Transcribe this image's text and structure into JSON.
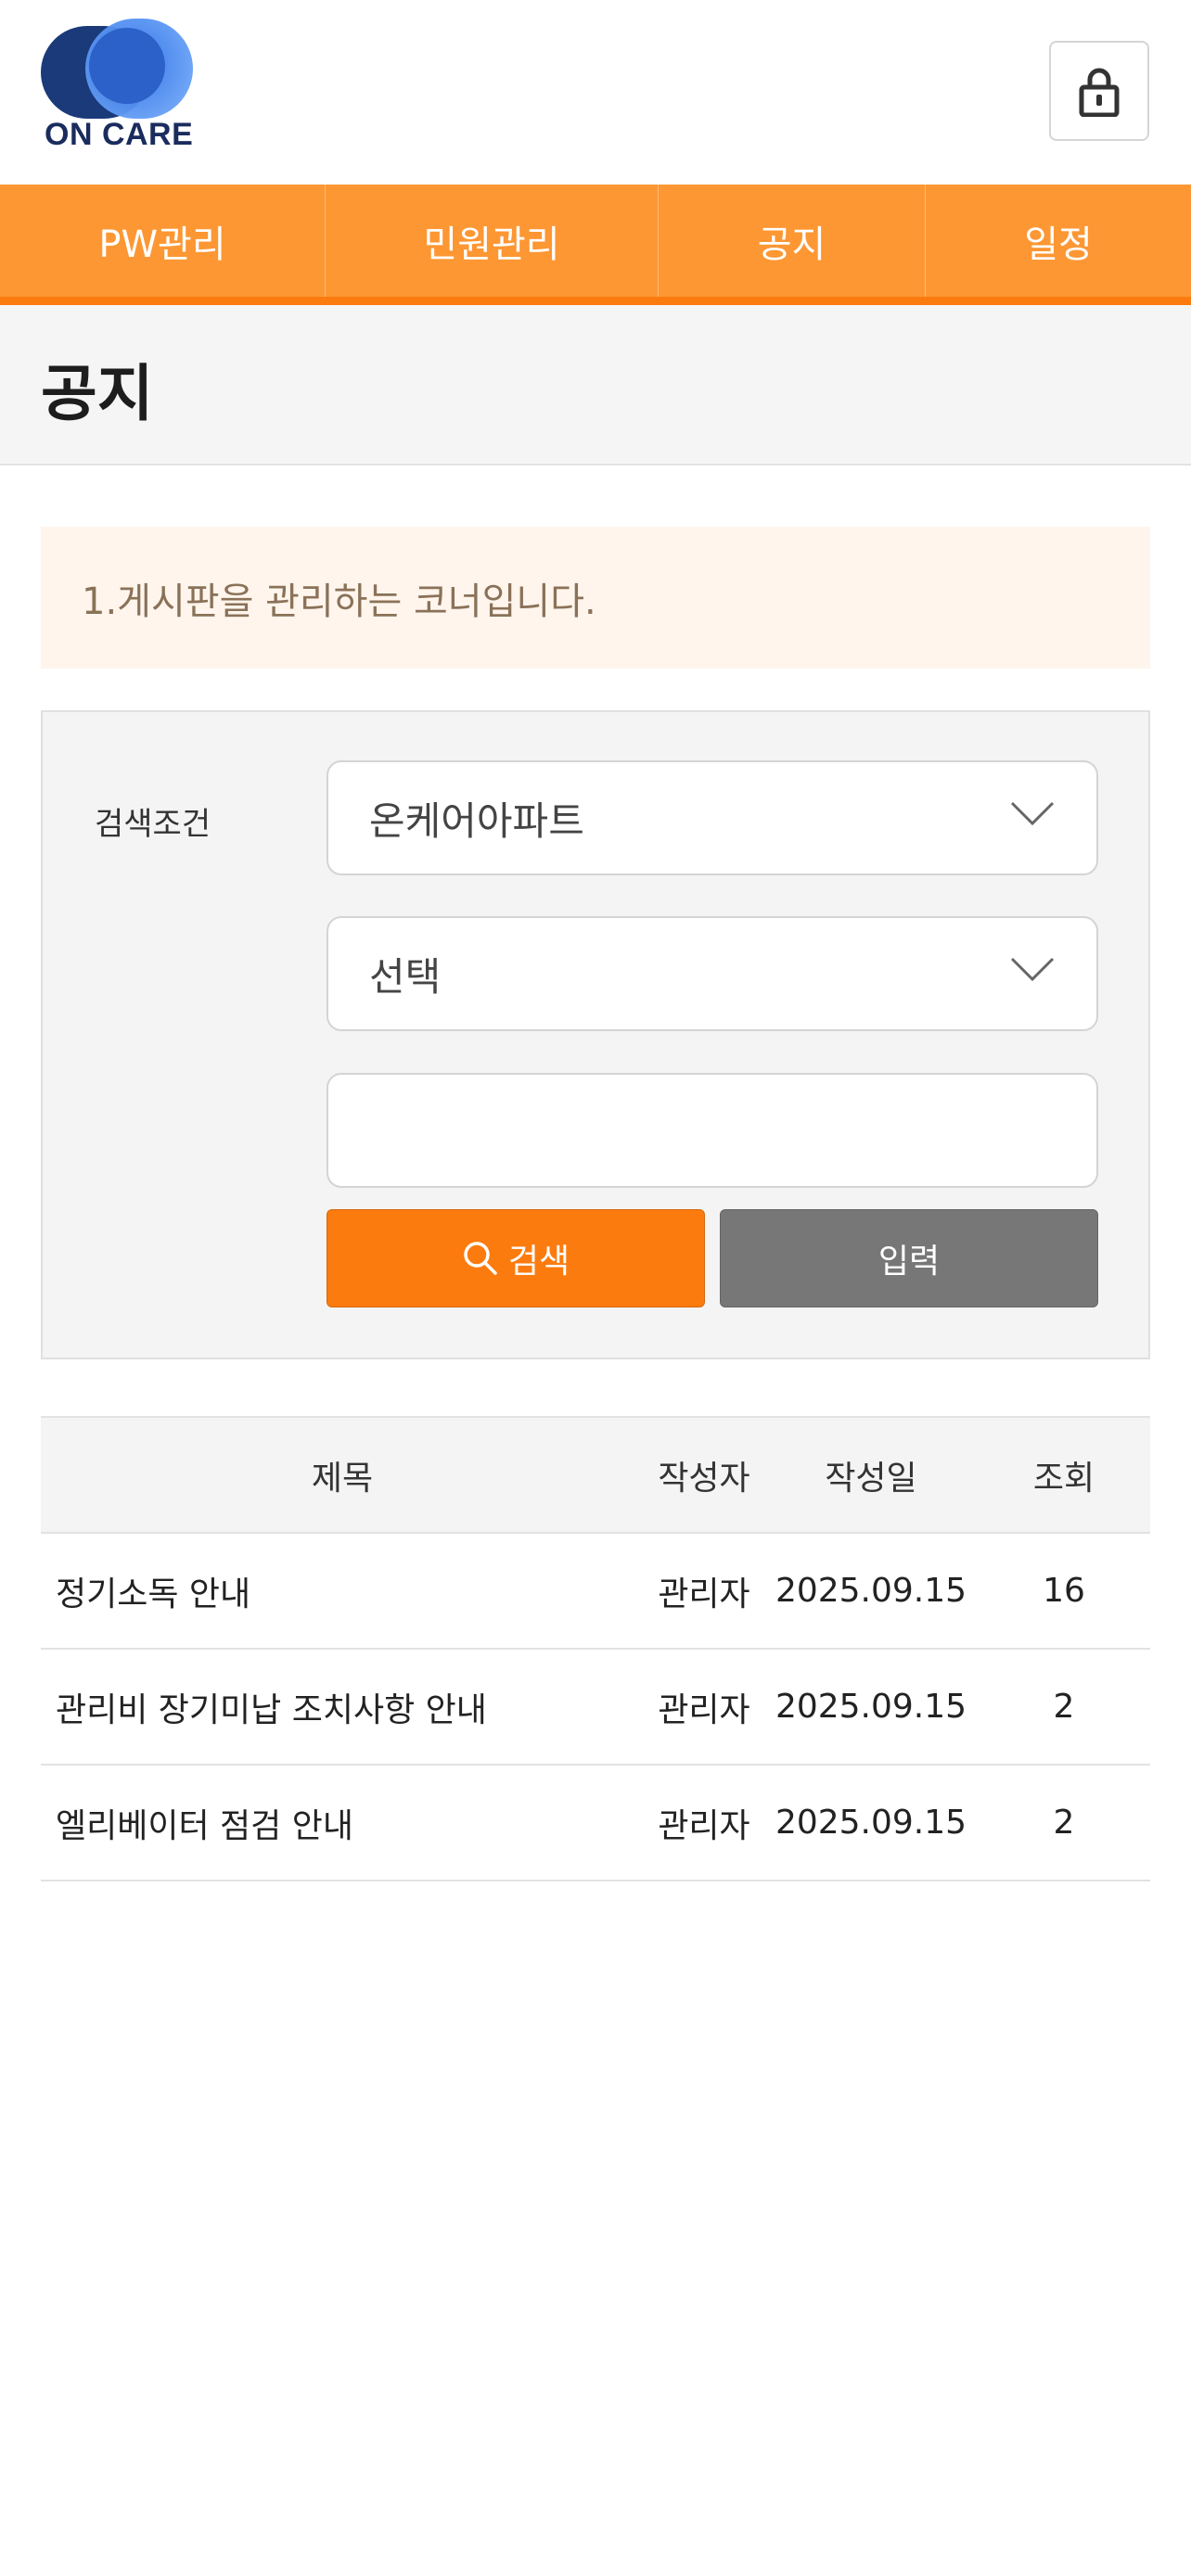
{
  "header": {
    "logo_text": "ON CARE",
    "lock_icon": "lock-icon"
  },
  "nav": {
    "items": [
      {
        "label": "PW관리"
      },
      {
        "label": "민원관리"
      },
      {
        "label": "공지"
      },
      {
        "label": "일정"
      }
    ]
  },
  "page": {
    "title": "공지",
    "notice": "1.게시판을 관리하는 코너입니다."
  },
  "search": {
    "label": "검색조건",
    "select1_value": "온케어아파트",
    "select2_value": "선택",
    "input_value": "",
    "search_button": "검색",
    "input_button": "입력",
    "icons": {
      "search": "search-icon",
      "chevron": "chevron-down-icon"
    }
  },
  "table": {
    "headers": {
      "title": "제목",
      "author": "작성자",
      "date": "작성일",
      "views": "조회"
    },
    "rows": [
      {
        "title": "정기소독 안내",
        "author": "관리자",
        "date": "2025.09.15",
        "views": "16"
      },
      {
        "title": "관리비 장기미납 조치사항 안내",
        "author": "관리자",
        "date": "2025.09.15",
        "views": "2"
      },
      {
        "title": "엘리베이터 점검 안내",
        "author": "관리자",
        "date": "2025.09.15",
        "views": "2"
      }
    ]
  },
  "colors": {
    "accent": "#fc7b0e",
    "nav_bg": "#fd9733",
    "notice_bg": "#fff5ed",
    "secondary_button": "#777777"
  }
}
